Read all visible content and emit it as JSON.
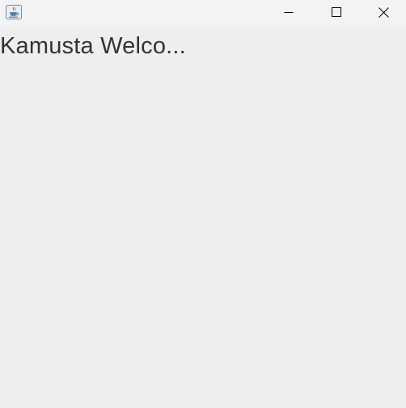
{
  "window": {
    "title": "",
    "icon": "java-cup-icon",
    "controls": {
      "minimize_icon": "minimize-icon",
      "maximize_icon": "maximize-icon",
      "close_icon": "close-icon"
    }
  },
  "content": {
    "label_text": "Kamusta Welco..."
  },
  "colors": {
    "titlebar_bg": "#f3f3f3",
    "content_bg": "#eeeeee",
    "label_color": "#333333",
    "java_orange": "#e76f00",
    "java_blue": "#5382a1"
  }
}
